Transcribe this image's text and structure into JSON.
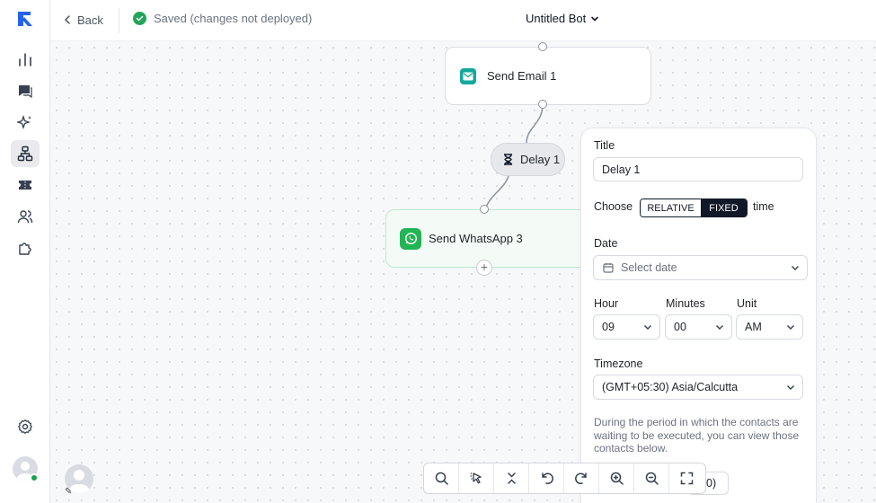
{
  "topbar": {
    "back_label": "Back",
    "status_text": "Saved (changes not deployed)",
    "bot_title": "Untitled Bot"
  },
  "sidebar": {
    "items": [
      {
        "icon": "analytics-icon"
      },
      {
        "icon": "chat-icon"
      },
      {
        "icon": "sparkles-icon"
      },
      {
        "icon": "flow-builder-icon",
        "active": true
      },
      {
        "icon": "tickets-icon"
      },
      {
        "icon": "contacts-icon"
      },
      {
        "icon": "integrations-icon"
      },
      {
        "icon": "settings-icon"
      }
    ]
  },
  "canvas": {
    "nodes": {
      "email": "Send Email 1",
      "delay": "Delay 1",
      "whatsapp": "Send WhatsApp 3"
    }
  },
  "panel": {
    "title_label": "Title",
    "title_value": "Delay 1",
    "choose_label": "Choose",
    "relative_option": "RELATIVE",
    "fixed_option": "FIXED",
    "time_suffix": "time",
    "selected_mode": "FIXED",
    "date_label": "Date",
    "date_placeholder": "Select date",
    "hour_label": "Hour",
    "hour_value": "09",
    "minutes_label": "Minutes",
    "minutes_value": "00",
    "unit_label": "Unit",
    "unit_value": "AM",
    "timezone_label": "Timezone",
    "timezone_value": "(GMT+05:30) Asia/Calcutta",
    "help_text": "During the period in which the contacts are waiting to be executed, you can view those contacts below.",
    "partial_button": "0)"
  },
  "toolbar": {
    "tools": [
      "search-icon",
      "magic-select-icon",
      "collapse-icon",
      "undo-icon",
      "redo-icon",
      "zoom-in-icon",
      "zoom-out-icon",
      "fullscreen-icon"
    ]
  },
  "colors": {
    "accent": "#1d4ed8",
    "success": "#22a55a",
    "email_teal": "#14a89a",
    "whatsapp_green": "#22b455",
    "dark": "#111827"
  }
}
